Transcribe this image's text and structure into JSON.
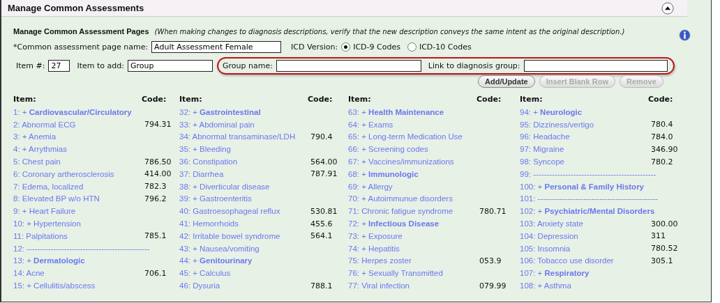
{
  "panel": {
    "title": "Manage Common Assessments"
  },
  "section": {
    "heading": "Manage Common Assessment Pages",
    "note": "(When making changes to diagnosis descriptions, verify that the new description conveys the same intent as the original description.)"
  },
  "page_name": {
    "label": "*Common assessment page name:",
    "value": "Adult Assessment Female"
  },
  "icd_version": {
    "label": "ICD Version:",
    "options": [
      {
        "label": "ICD-9 Codes",
        "selected": true
      },
      {
        "label": "ICD-10 Codes",
        "selected": false
      }
    ]
  },
  "item_number": {
    "label": "Item #:",
    "value": "27"
  },
  "item_to_add": {
    "label": "Item to add:",
    "value": "Group"
  },
  "group_name": {
    "label": "Group name:"
  },
  "link_group": {
    "label": "Link to diagnosis group:"
  },
  "buttons": [
    {
      "label": "Add/Update",
      "disabled": false
    },
    {
      "label": "Insert Blank Row",
      "disabled": true
    },
    {
      "label": "Remove",
      "disabled": true
    }
  ],
  "columns": [
    {
      "item_header": "Item:",
      "code_header": "Code:",
      "rows": [
        {
          "text": "1: + **Cardiovascular/Circulatory**"
        },
        {
          "text": "2: Abnormal ECG",
          "code": "794.31"
        },
        {
          "text": "3: + Anemia"
        },
        {
          "text": "4: + Arrythmias"
        },
        {
          "text": "5: Chest pain",
          "code": "786.50"
        },
        {
          "text": "6: Coronary artherosclerosis",
          "code": "414.00"
        },
        {
          "text": "7: Edema, localized",
          "code": "782.3"
        },
        {
          "text": "8: Elevated BP w/o HTN",
          "code": "796.2"
        },
        {
          "text": "9: + Heart Failure"
        },
        {
          "text": "10: + Hypertension"
        },
        {
          "text": "11: Palpitations",
          "code": "785.1"
        },
        {
          "text": "12: ----------------------------------------------"
        },
        {
          "text": "13: + **Dermatologic**"
        },
        {
          "text": "14: Acne",
          "code": "706.1"
        },
        {
          "text": "15: + Cellulitis/abscess"
        }
      ]
    },
    {
      "item_header": "Item:",
      "code_header": "Code:",
      "rows": [
        {
          "text": "32: + **Gastrointestinal**"
        },
        {
          "text": "33: + Abdominal pain"
        },
        {
          "text": "34: Abnormal transaminase/LDH",
          "code": "790.4"
        },
        {
          "text": "35: + Bleeding"
        },
        {
          "text": "36: Constipation",
          "code": "564.00"
        },
        {
          "text": "37: Diarrhea",
          "code": "787.91"
        },
        {
          "text": "38: + Diverticular disease"
        },
        {
          "text": "39: + Gastroenteritis"
        },
        {
          "text": "40: Gastroesophageal reflux",
          "code": "530.81"
        },
        {
          "text": "41: Hemorrhoids",
          "code": "455.6"
        },
        {
          "text": "42: Irritable bowel syndrome",
          "code": "564.1"
        },
        {
          "text": "43: + Nausea/vomiting"
        },
        {
          "text": "44: + **Genitourinary**"
        },
        {
          "text": "45: + Calculus"
        },
        {
          "text": "46: Dysuria",
          "code": "788.1"
        }
      ]
    },
    {
      "item_header": "Item:",
      "code_header": "Code:",
      "rows": [
        {
          "text": "63: + **Health Maintenance**"
        },
        {
          "text": "64: + Exams"
        },
        {
          "text": "65: + Long-term Medication Use"
        },
        {
          "text": "66: + Screening codes"
        },
        {
          "text": "67: + Vaccines/immunizations"
        },
        {
          "text": "68: + **Immunologic**"
        },
        {
          "text": "69: + Allergy"
        },
        {
          "text": "70: + Autoimmunue disorders"
        },
        {
          "text": "71: Chronic fatigue syndrome",
          "code": "780.71"
        },
        {
          "text": "72: + **Infectious Disease**"
        },
        {
          "text": "73: + Exposure"
        },
        {
          "text": "74: + Hepatitis"
        },
        {
          "text": "75: Herpes zoster",
          "code": "053.9"
        },
        {
          "text": "76: + Sexually Transmitted"
        },
        {
          "text": "77: Viral infection",
          "code": "079.99"
        }
      ]
    },
    {
      "item_header": "Item:",
      "code_header": "Code:",
      "rows": [
        {
          "text": "94: + **Neurologic**"
        },
        {
          "text": "95: Dizziness/vertigo",
          "code": "780.4"
        },
        {
          "text": "96: Headache",
          "code": "784.0"
        },
        {
          "text": "97: Migraine",
          "code": "346.90"
        },
        {
          "text": "98: Syncope",
          "code": "780.2"
        },
        {
          "text": "99: ----------------------------------------------"
        },
        {
          "text": "100: + **Personal & Family History**"
        },
        {
          "text": "101: ---------------------------------------------"
        },
        {
          "text": "102: + **Psychiatric/Mental Disorders**"
        },
        {
          "text": "103: Anxiety state",
          "code": "300.00"
        },
        {
          "text": "104: Depression",
          "code": "311"
        },
        {
          "text": "105: Insomnia",
          "code": "780.52"
        },
        {
          "text": "106: Tobacco use disorder",
          "code": "305.1"
        },
        {
          "text": "107: + **Respiratory**"
        },
        {
          "text": "108: + Asthma"
        }
      ]
    }
  ]
}
